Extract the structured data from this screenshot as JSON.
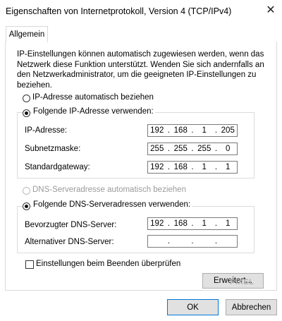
{
  "window": {
    "title": "Eigenschaften von Internetprotokoll, Version 4 (TCP/IPv4)",
    "close_glyph": "✕"
  },
  "tabs": [
    {
      "label": "Allgemein",
      "active": true
    }
  ],
  "intro_text": "IP-Einstellungen können automatisch zugewiesen werden, wenn das Netzwerk diese Funktion unterstützt. Wenden Sie sich andernfalls an den Netzwerkadministrator, um die geeigneten IP-Einstellungen zu beziehen.",
  "ip_mode": {
    "auto_label": "IP-Adresse automatisch beziehen",
    "manual_label": "Folgende IP-Adresse verwenden:",
    "selected": "manual"
  },
  "ip_fields": {
    "ip_label": "IP-Adresse:",
    "ip": [
      "192",
      "168",
      "1",
      "205"
    ],
    "mask_label": "Subnetzmaske:",
    "mask": [
      "255",
      "255",
      "255",
      "0"
    ],
    "gateway_label": "Standardgateway:",
    "gateway": [
      "192",
      "168",
      "1",
      "1"
    ]
  },
  "dns_mode": {
    "auto_label": "DNS-Serveradresse automatisch beziehen",
    "manual_label": "Folgende DNS-Serveradressen verwenden:",
    "selected": "manual",
    "auto_disabled": true
  },
  "dns_fields": {
    "preferred_label": "Bevorzugter DNS-Server:",
    "preferred": [
      "192",
      "168",
      "1",
      "1"
    ],
    "alternate_label": "Alternativer DNS-Server:",
    "alternate": [
      "",
      "",
      "",
      ""
    ]
  },
  "validate_checkbox": {
    "label": "Einstellungen beim Beenden überprüfen",
    "checked": false
  },
  "buttons": {
    "advanced": "Erweitert...",
    "ok": "OK",
    "cancel": "Abbrechen"
  },
  "watermark": "PIXEL"
}
